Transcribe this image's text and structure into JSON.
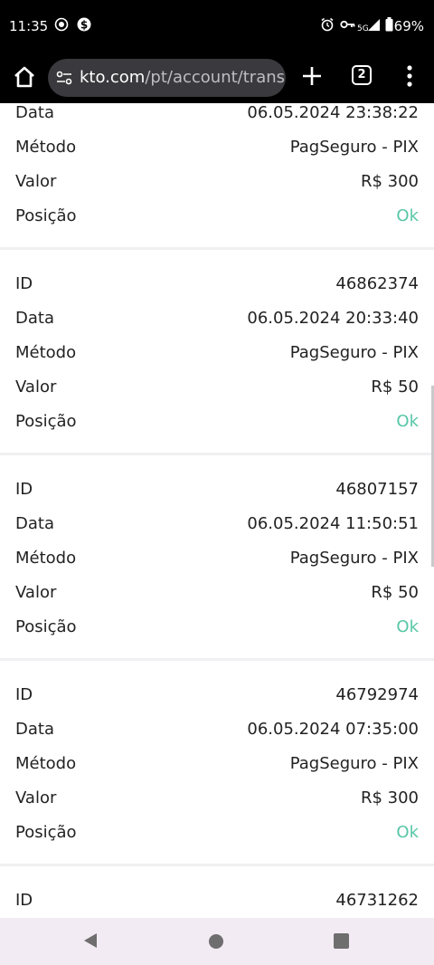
{
  "status_bar": {
    "time": "11:35",
    "network": "5G",
    "battery": "69%"
  },
  "browser": {
    "url_domain": "kto.com",
    "url_path": "/pt/account/transa",
    "tab_count": "2"
  },
  "labels": {
    "id": "ID",
    "date": "Data",
    "method": "Método",
    "value": "Valor",
    "status": "Posição"
  },
  "transactions": [
    {
      "date": "06.05.2024 23:38:22",
      "method": "PagSeguro - PIX",
      "value": "R$ 300",
      "status": "Ok"
    },
    {
      "id": "46862374",
      "date": "06.05.2024 20:33:40",
      "method": "PagSeguro - PIX",
      "value": "R$ 50",
      "status": "Ok"
    },
    {
      "id": "46807157",
      "date": "06.05.2024 11:50:51",
      "method": "PagSeguro - PIX",
      "value": "R$ 50",
      "status": "Ok"
    },
    {
      "id": "46792974",
      "date": "06.05.2024 07:35:00",
      "method": "PagSeguro - PIX",
      "value": "R$ 300",
      "status": "Ok"
    },
    {
      "id": "46731262"
    }
  ]
}
